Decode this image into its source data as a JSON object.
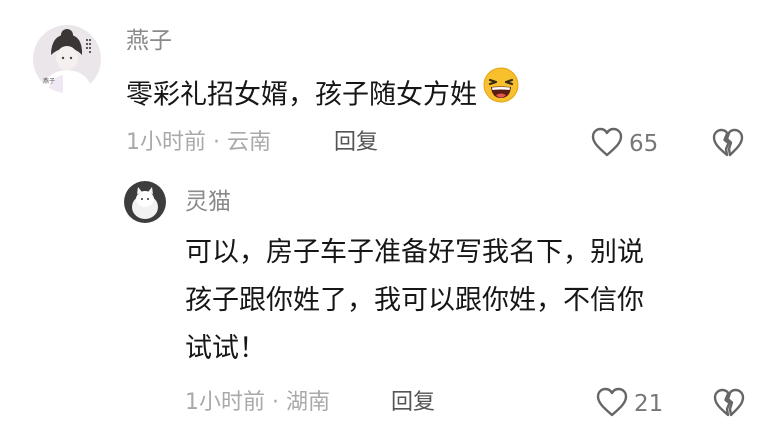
{
  "comment": {
    "username": "燕子",
    "text": "零彩礼招女婿，孩子随女方姓",
    "emoji": "laughing-face",
    "meta": "1小时前 · 云南",
    "reply_label": "回复",
    "likes": "65",
    "avatar_text": "燕子"
  },
  "reply": {
    "username": "灵猫",
    "lines": [
      "可以，房子车子准备好写我名下，别说",
      "孩子跟你姓了，我可以跟你姓，不信你",
      "试试！"
    ],
    "meta": "1小时前 · 湖南",
    "reply_label": "回复",
    "likes": "21"
  },
  "icons": {
    "like": "heart-outline-icon",
    "dislike": "broken-heart-icon"
  },
  "colors": {
    "username": "#8a8a8a",
    "text": "#161616",
    "meta": "#a9a9a9",
    "icon": "#666666"
  }
}
